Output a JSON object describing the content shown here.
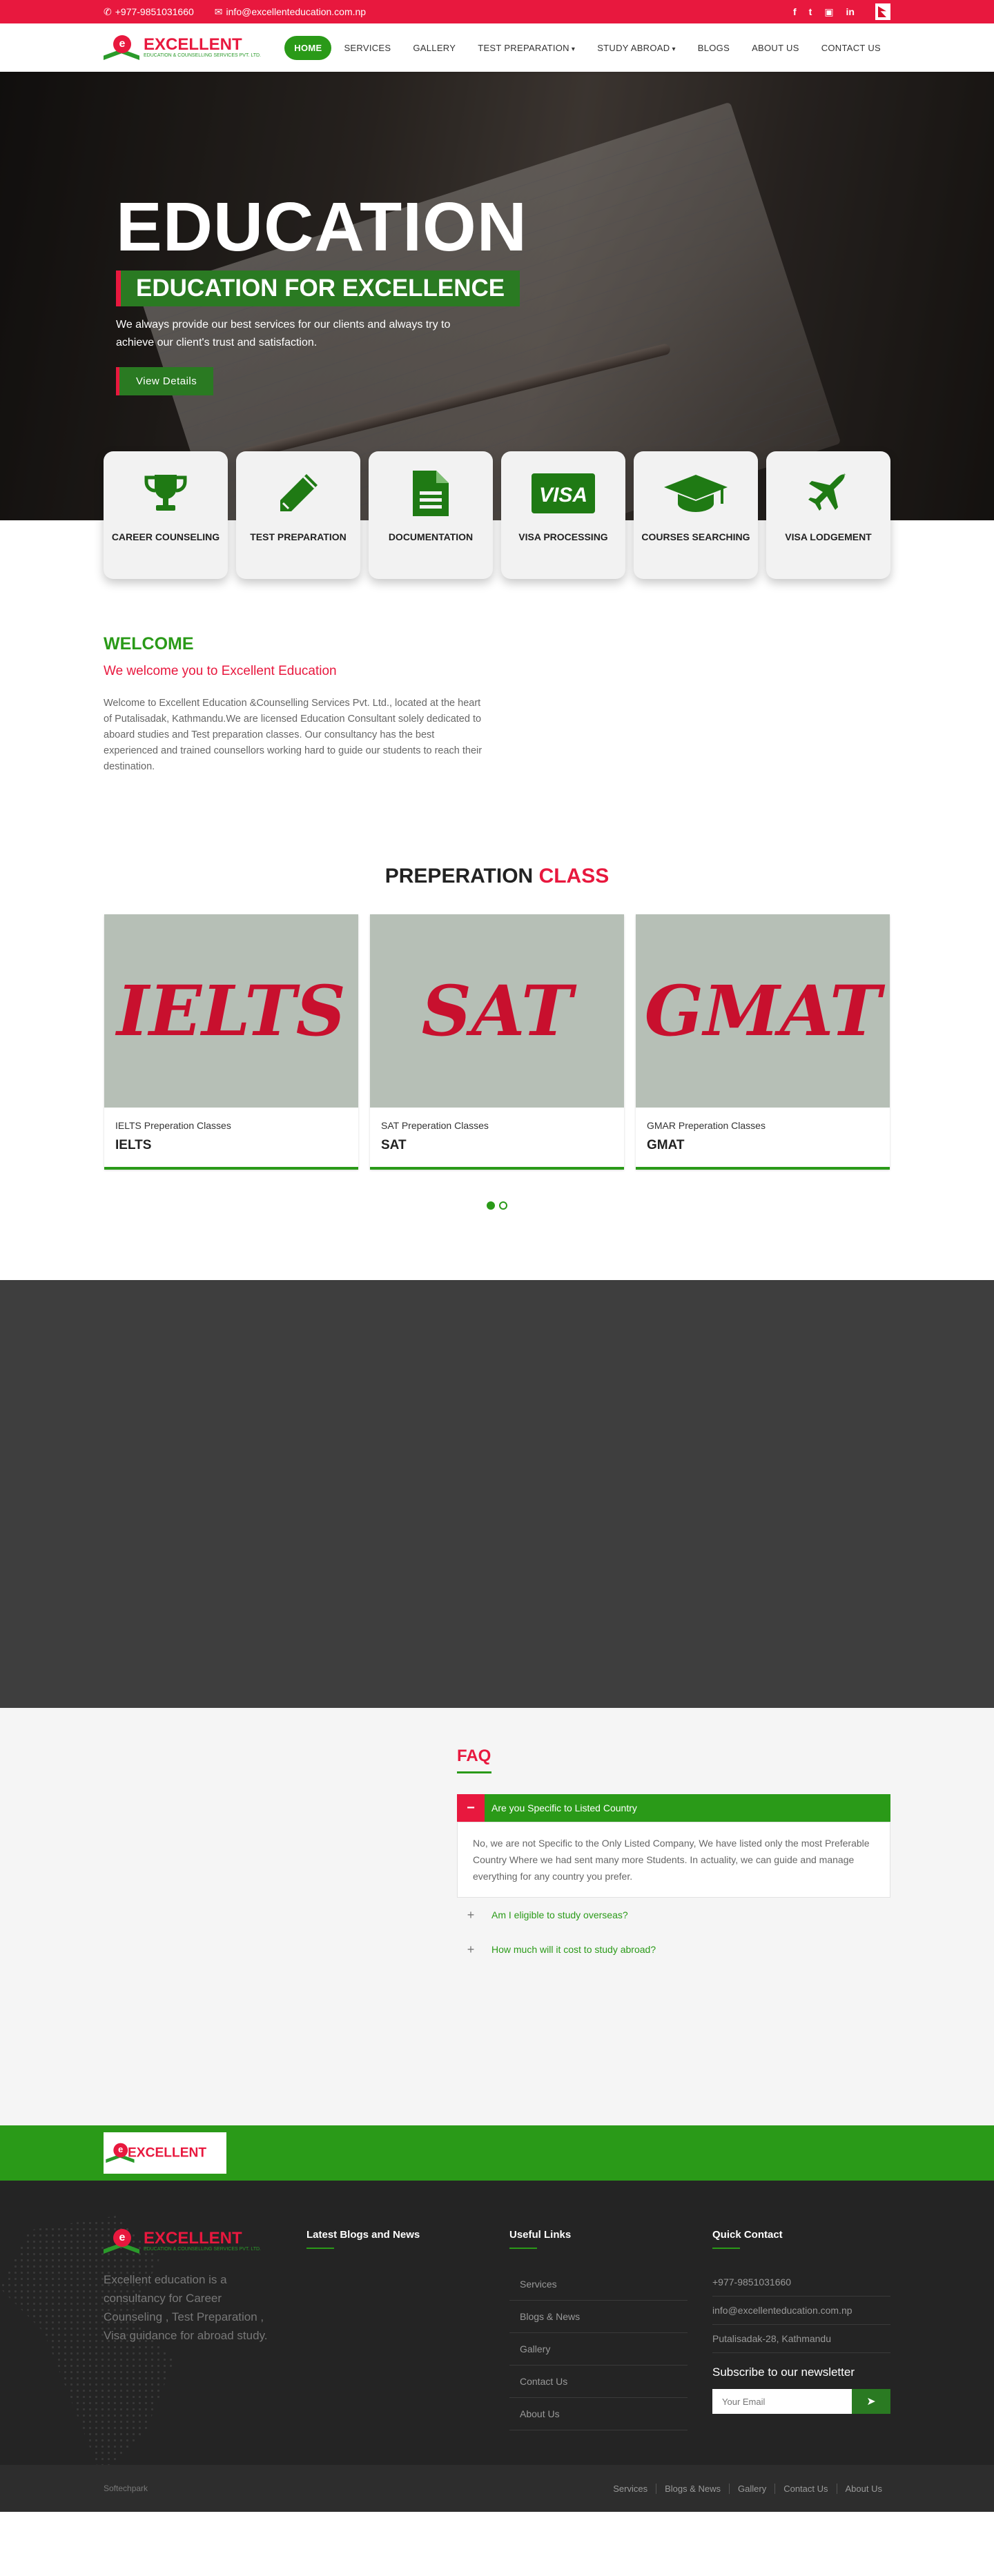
{
  "topbar": {
    "phone": "+977-9851031660",
    "email": "info@excellenteducation.com.np",
    "social_icons": [
      "facebook-icon",
      "twitter-icon",
      "instagram-icon",
      "linkedin-icon"
    ]
  },
  "logo": {
    "name": "EXCELLENT",
    "tagline": "EDUCATION & COUNSELLING SERVICES PVT. LTD."
  },
  "nav": {
    "items": [
      {
        "label": "HOME",
        "active": true
      },
      {
        "label": "SERVICES"
      },
      {
        "label": "GALLERY"
      },
      {
        "label": "TEST PREPARATION",
        "dropdown": true
      },
      {
        "label": "STUDY ABROAD",
        "dropdown": true
      },
      {
        "label": "BLOGS"
      },
      {
        "label": "ABOUT US"
      },
      {
        "label": "CONTACT US"
      }
    ]
  },
  "hero": {
    "title": "EDUCATION",
    "subtitle": "EDUCATION FOR EXCELLENCE",
    "text": "We always provide our best services for our clients and always try to achieve our client's trust and satisfaction.",
    "button": "View Details"
  },
  "services": [
    {
      "label": "CAREER COUNSELING",
      "icon": "trophy-icon"
    },
    {
      "label": "TEST PREPARATION",
      "icon": "pencil-icon"
    },
    {
      "label": "DOCUMENTATION",
      "icon": "document-icon"
    },
    {
      "label": "VISA PROCESSING",
      "icon": "visa-card-icon",
      "icon_text": "VISA"
    },
    {
      "label": "COURSES SEARCHING",
      "icon": "graduation-cap-icon"
    },
    {
      "label": "VISA LODGEMENT",
      "icon": "plane-icon"
    }
  ],
  "welcome": {
    "title": "WELCOME",
    "subtitle": "We welcome you to Excellent Education",
    "text": "Welcome to Excellent Education &Counselling Services Pvt. Ltd., located at the heart of Putalisadak, Kathmandu.We are licensed Education Consultant solely dedicated to aboard studies  and Test preparation classes. Our consultancy has the best experienced and trained counsellors working hard to guide our students to reach their destination."
  },
  "prep": {
    "title_part1": "PREPERATION",
    "title_part2": "CLASS",
    "cards": [
      {
        "image_text": "IELTS",
        "small": "IELTS Preperation Classes",
        "big": "IELTS"
      },
      {
        "image_text": "SAT",
        "small": "SAT Preperation Classes",
        "big": "SAT"
      },
      {
        "image_text": "GMAT",
        "small": "GMAR Preperation Classes",
        "big": "GMAT"
      }
    ],
    "active_page": 1,
    "pages": 2
  },
  "faq": {
    "title": "FAQ",
    "open": {
      "question": "Are you Specific to Listed Country",
      "answer": "No, we are not Specific to the Only Listed Company, We have listed only the most Preferable Country Where we had sent many more Students. In actuality, we can guide and manage everything for any country you prefer."
    },
    "closed": [
      "Am I eligible to study overseas?",
      "How much will it cost to study abroad?"
    ]
  },
  "footer": {
    "about": "Excellent education is a consultancy for Career Counseling , Test Preparation , Visa guidance for abroad study.",
    "blogs_title": "Latest Blogs and News",
    "links_title": "Useful Links",
    "links": [
      "Services",
      "Blogs & News",
      "Gallery",
      "Contact Us",
      "About Us"
    ],
    "contact_title": "Quick Contact",
    "contact": [
      "+977-9851031660",
      "info@excellenteducation.com.np",
      "Putalisadak-28, Kathmandu"
    ],
    "subscribe_title": "Subscribe to our newsletter",
    "email_placeholder": "Your Email"
  },
  "bottom": {
    "copy": "Softechpark",
    "links": [
      "Services",
      "Blogs & News",
      "Gallery",
      "Contact Us",
      "About Us"
    ]
  },
  "colors": {
    "brand_red": "#e8183e",
    "brand_green": "#2a9a18",
    "dark": "#3e3e3e"
  }
}
